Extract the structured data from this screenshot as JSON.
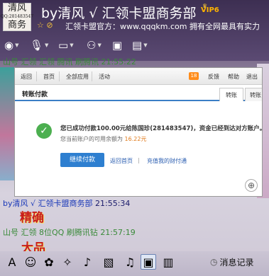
{
  "header": {
    "logo_text_top": "清风",
    "logo_text_num": "QQ:281483547",
    "logo_text_bottom": "商务",
    "title": "by清风 √ 汇领卡盟商务部",
    "vip_badge": "VIP6",
    "announcement": "汇领卡盟官方：www.qqqkm.com 拥有全网最具有实力"
  },
  "toolbar": {
    "buttons": [
      {
        "name": "video",
        "icon": "camera-icon"
      },
      {
        "name": "voice",
        "icon": "microphone-icon"
      },
      {
        "name": "file",
        "icon": "folder-icon"
      },
      {
        "name": "invite",
        "icon": "add-person-icon"
      },
      {
        "name": "screen",
        "icon": "monitor-icon"
      },
      {
        "name": "apps",
        "icon": "clipboard-icon"
      }
    ]
  },
  "chat": {
    "top_faint": "山号 汇领 汇领 腾讯 刷腾讯 21:55:22",
    "msg1_sender": "by清风 √ 汇领卡盟商务部",
    "msg1_time": "21:55:34",
    "fancy1": "精确",
    "faint_line": "山号 汇领 8位QQ 刷腾讯钻",
    "faint_time": "21:57:19",
    "fancy2": "大品"
  },
  "screenshot": {
    "nav": {
      "back": "返回",
      "home": "首页",
      "all_apps": "全部应用",
      "activity": "活动",
      "badge": "18",
      "feedback": "反馈",
      "help": "帮助",
      "logout": "退出"
    },
    "page_title": "转账付款",
    "tabs": [
      "转账",
      "转账"
    ],
    "success_message": "您已成功付款100.00元给陈国珍(281483547)，资金已经到达对方账户。",
    "balance_prefix": "您当前账户的可用余额为",
    "balance_amount": "16.22元",
    "continue_button": "继续付款",
    "link_home": "返回首页",
    "link_sep": "|",
    "link_recharge": "充值我的财付通"
  },
  "bottom": {
    "history_label": "消息记录"
  },
  "colors": {
    "header_bg": "#3d2f52",
    "accent_blue": "#2e7fd0",
    "success_green": "#4caf50",
    "chat_sender": "#1a38b8",
    "fancy_red": "#c81d1d"
  }
}
